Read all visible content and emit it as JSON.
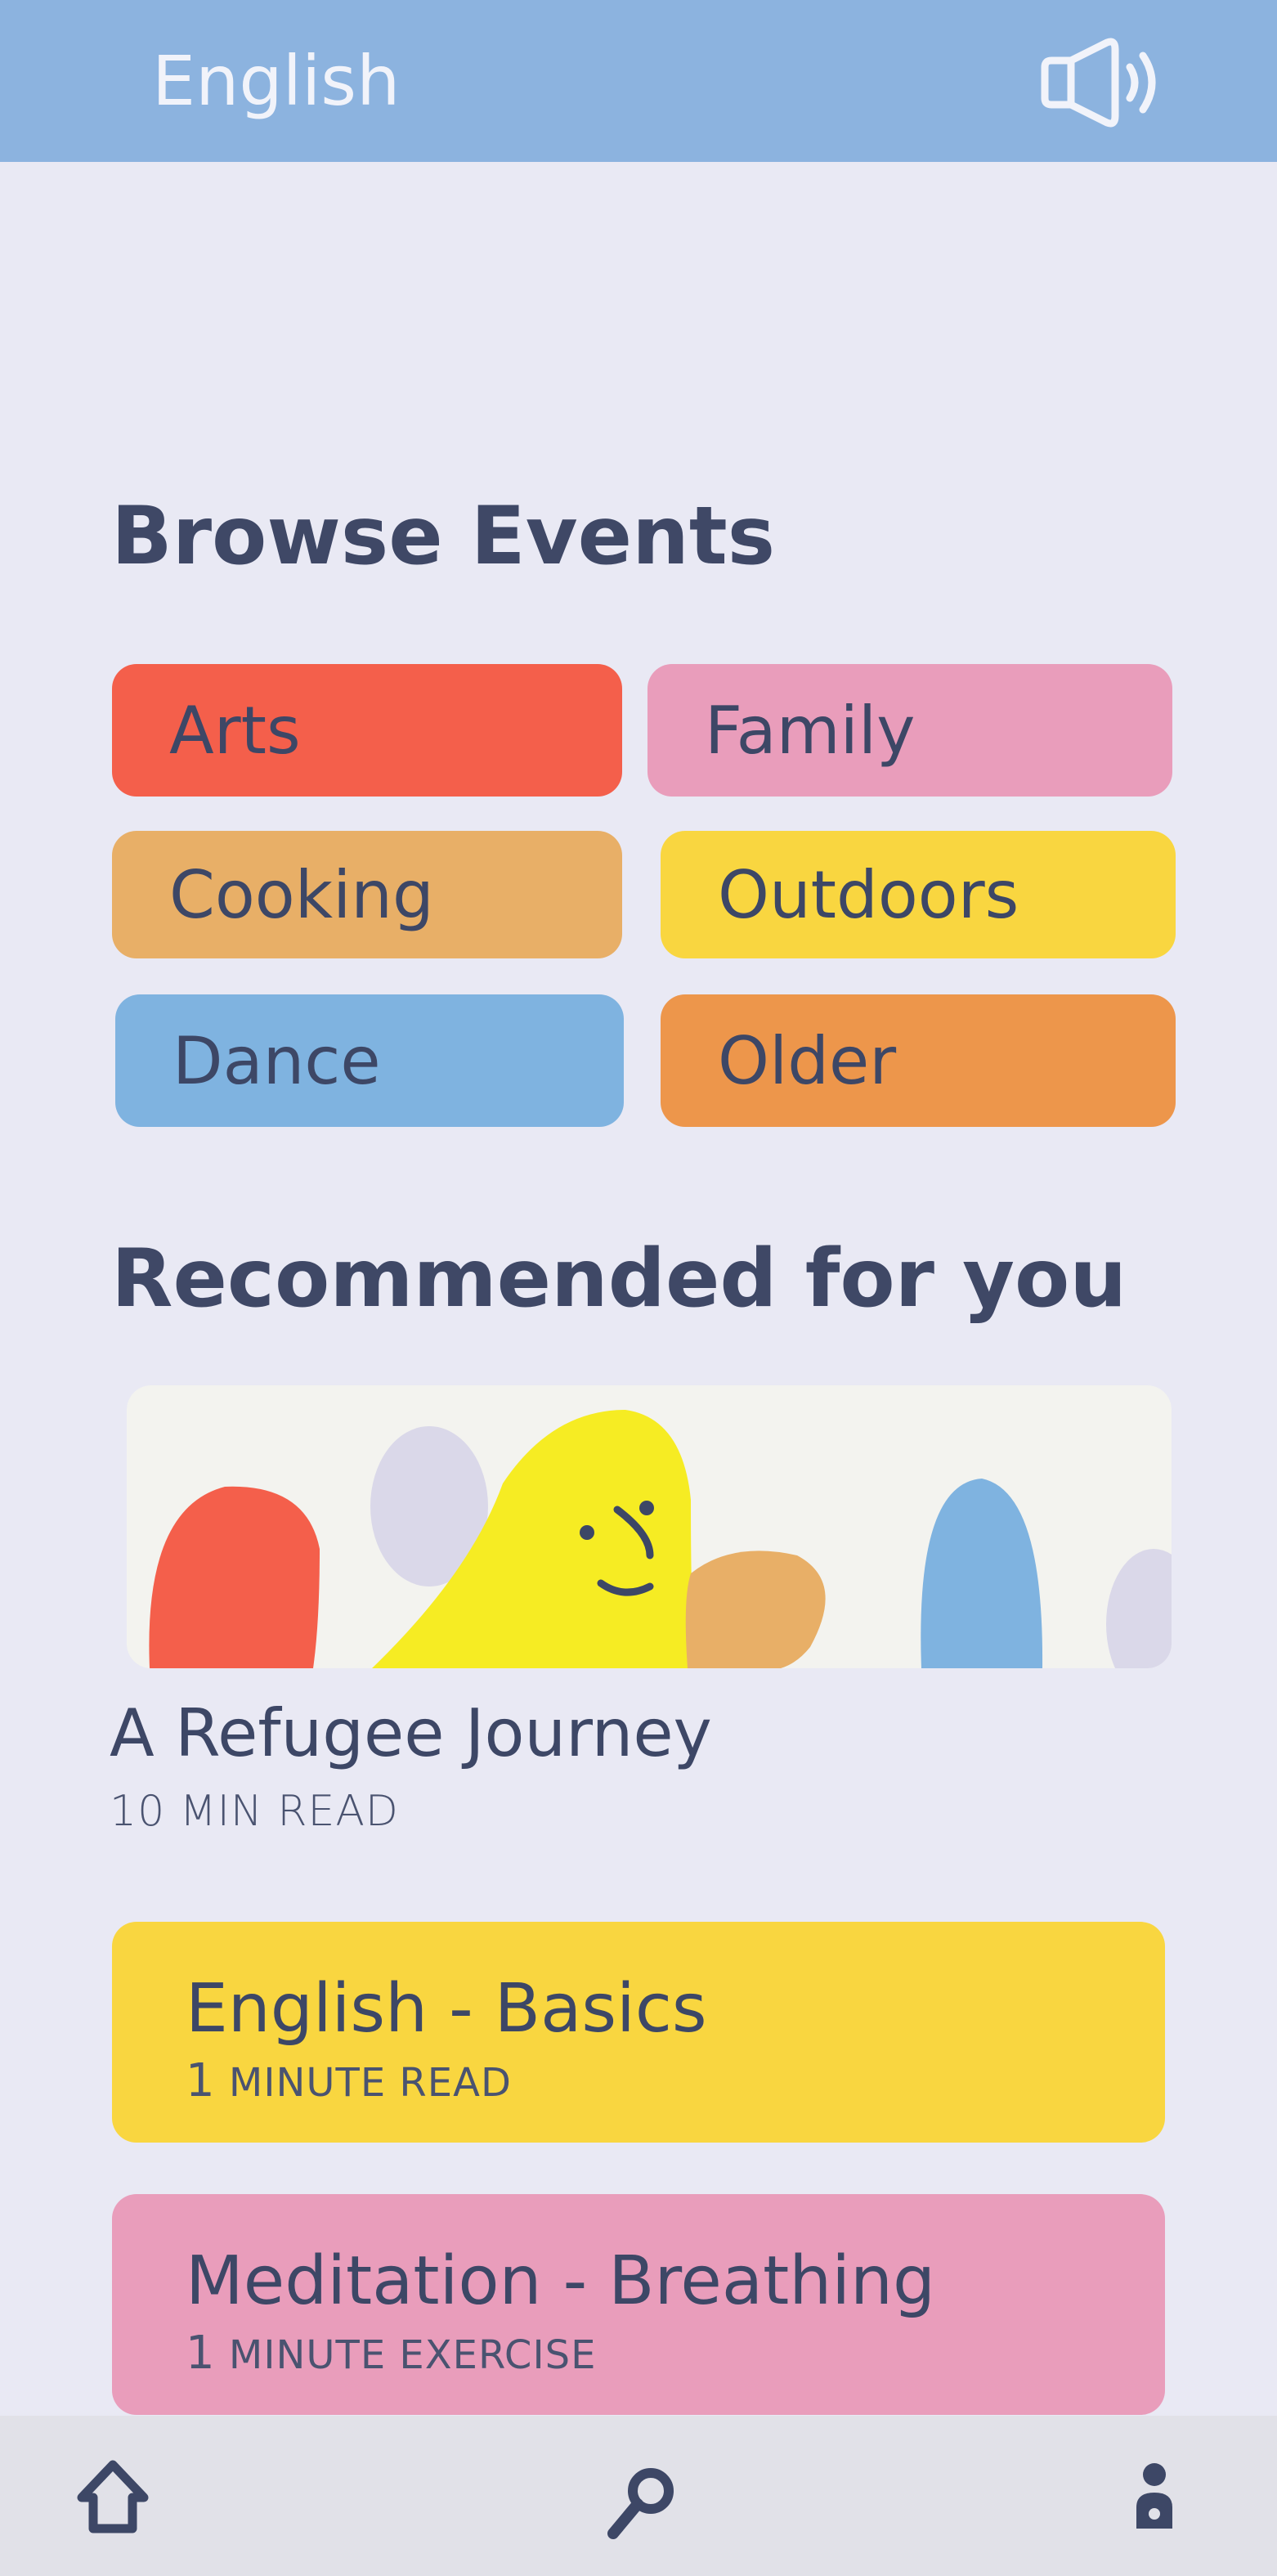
{
  "header": {
    "language": "English",
    "speaker_icon": "speaker-icon"
  },
  "browse": {
    "title": "Browse Events",
    "categories": [
      {
        "label": "Arts",
        "color": "#F45F4B"
      },
      {
        "label": "Family",
        "color": "#E99DBB"
      },
      {
        "label": "Cooking",
        "color": "#E8AF67"
      },
      {
        "label": "Outdoors",
        "color": "#F9D640"
      },
      {
        "label": "Dance",
        "color": "#7FB3E0"
      },
      {
        "label": "Older",
        "color": "#ED964B"
      }
    ]
  },
  "recommended": {
    "title": "Recommended for you",
    "featured": {
      "title": "A Refugee Journey",
      "meta": "10 MIN READ"
    },
    "cards": [
      {
        "title": "English - Basics",
        "number": "1",
        "meta": "MINUTE READ",
        "color": "#F9D640"
      },
      {
        "title": "Meditation - Breathing",
        "number": "1",
        "meta": "MINUTE EXERCISE",
        "color": "#E99DBB"
      }
    ]
  },
  "tabbar": {
    "items": [
      "home-icon",
      "search-icon",
      "profile-icon"
    ]
  }
}
